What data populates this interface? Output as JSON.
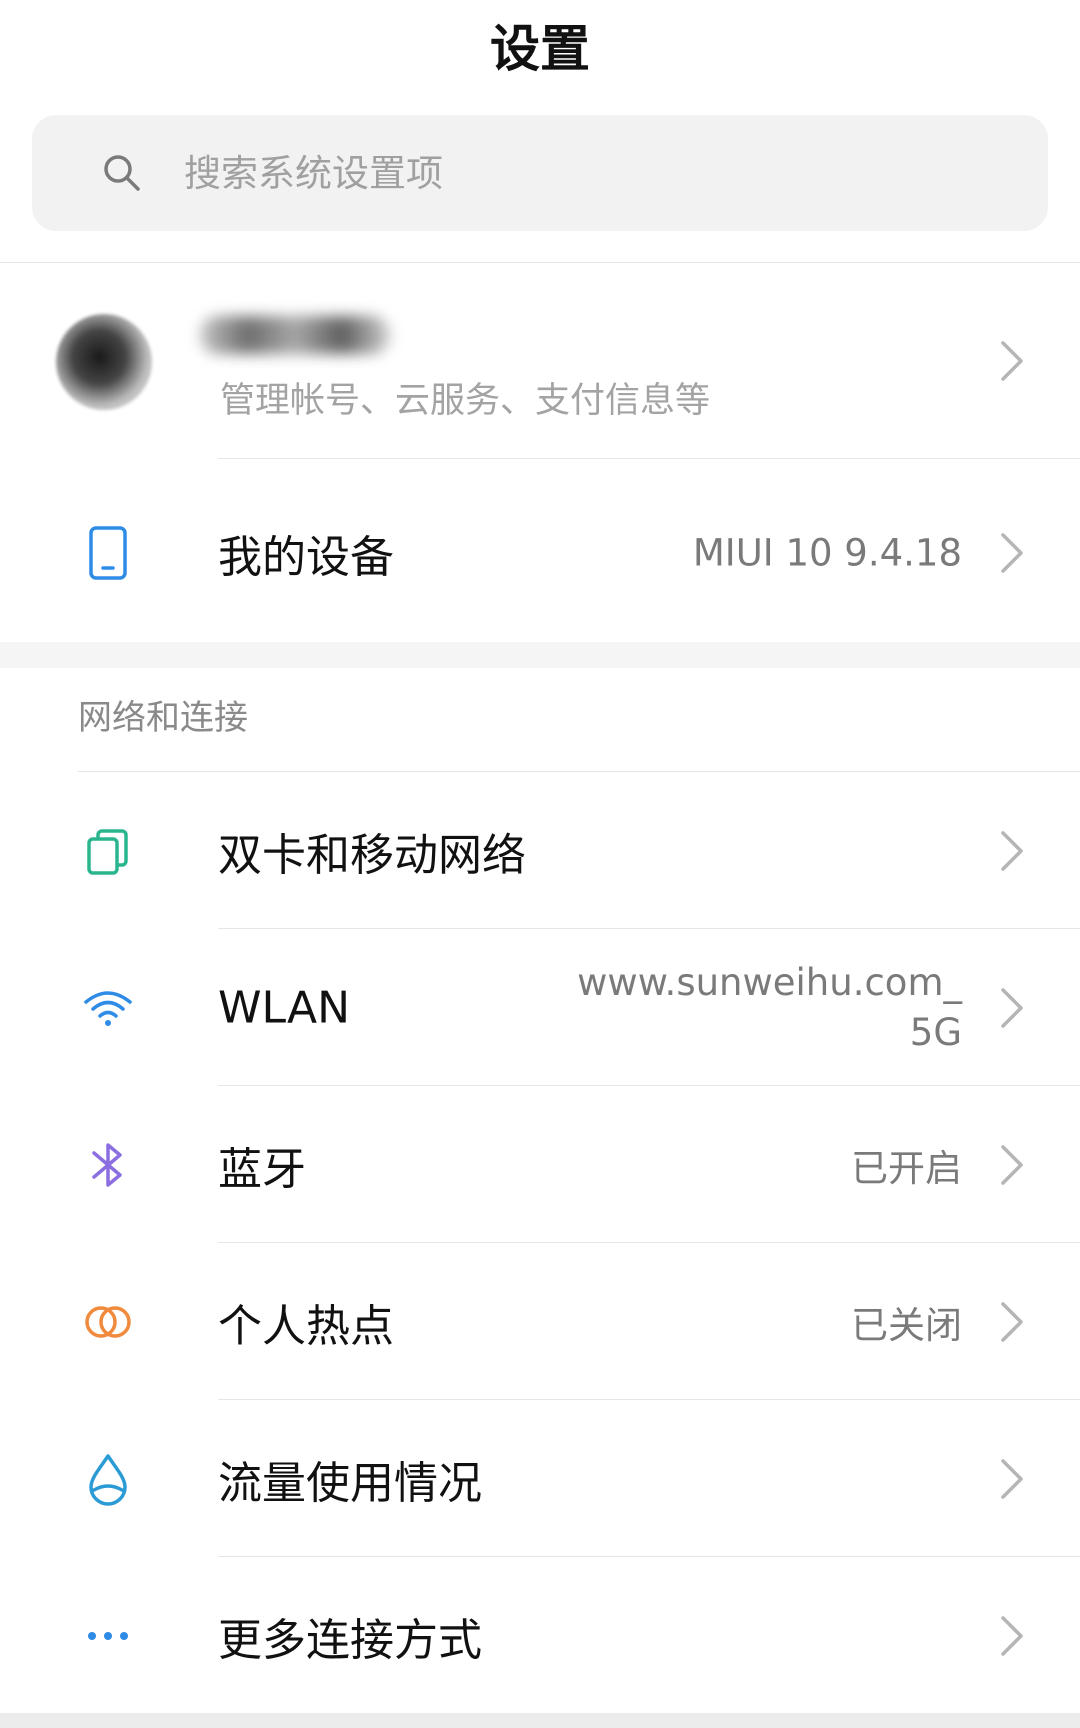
{
  "header": {
    "title": "设置"
  },
  "search": {
    "placeholder": "搜索系统设置项",
    "icon": "search-icon"
  },
  "account": {
    "subtitle": "管理帐号、云服务、支付信息等",
    "name_obscured": true
  },
  "device": {
    "label": "我的设备",
    "value": "MIUI 10 9.4.18",
    "icon": "phone-icon"
  },
  "network_section": {
    "header": "网络和连接",
    "items": [
      {
        "label": "双卡和移动网络",
        "value": "",
        "icon": "sim-cards-icon",
        "icon_color": "#2bb58f"
      },
      {
        "label": "WLAN",
        "value": "www.sunweihu.com_ 5G",
        "icon": "wifi-icon",
        "icon_color": "#2e8be6"
      },
      {
        "label": "蓝牙",
        "value": "已开启",
        "icon": "bluetooth-icon",
        "icon_color": "#8b6fe0"
      },
      {
        "label": "个人热点",
        "value": "已关闭",
        "icon": "hotspot-icon",
        "icon_color": "#f08a3c"
      },
      {
        "label": "流量使用情况",
        "value": "",
        "icon": "data-usage-icon",
        "icon_color": "#2b9bd6"
      },
      {
        "label": "更多连接方式",
        "value": "",
        "icon": "more-dots-icon",
        "icon_color": "#2e8be6"
      }
    ]
  },
  "colors": {
    "divider": "#e6e6e6",
    "section_gap": "#f5f5f5",
    "secondary_text": "#7a7a7a",
    "chevron": "#b5b5b5"
  }
}
